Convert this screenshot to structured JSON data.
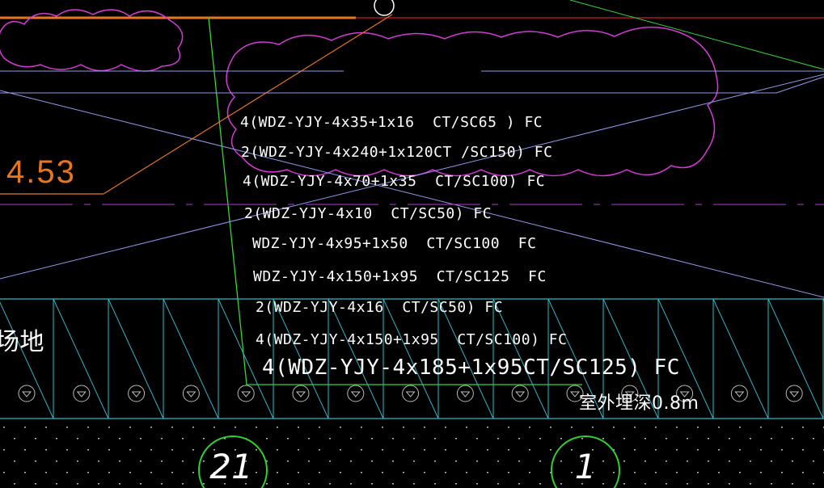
{
  "drawing": {
    "cable_labels": [
      "4(WDZ-YJY-4x35+1x16  CT/SC65 ) FC",
      "2(WDZ-YJY-4x240+1x120CT /SC150) FC",
      "4(WDZ-YJY-4x70+1x35  CT/SC100) FC",
      "2(WDZ-YJY-4x10  CT/SC50) FC",
      "WDZ-YJY-4x95+1x50  CT/SC100  FC",
      "WDZ-YJY-4x150+1x95  CT/SC125  FC",
      "2(WDZ-YJY-4x16  CT/SC50) FC",
      "4(WDZ-YJY-4x150+1x95  CT/SC100) FC",
      "4(WDZ-YJY-4x185+1x95CT/SC125) FC"
    ],
    "elevation_label": "4.53",
    "burial_depth_label": "室外埋深0.8m",
    "left_partial_label": "场地",
    "axis_labels": [
      "21",
      "1"
    ],
    "colors": {
      "background": "#000000",
      "text": "#ffffff",
      "elevation": "#e8761e",
      "cloud": "#d63ad6",
      "line_blue": "#8f9af0",
      "line_cyan": "#2fb8c8",
      "line_green": "#35d635",
      "axis_circle": "#2ed12e",
      "ground_dots": "#bbbbbb"
    }
  }
}
